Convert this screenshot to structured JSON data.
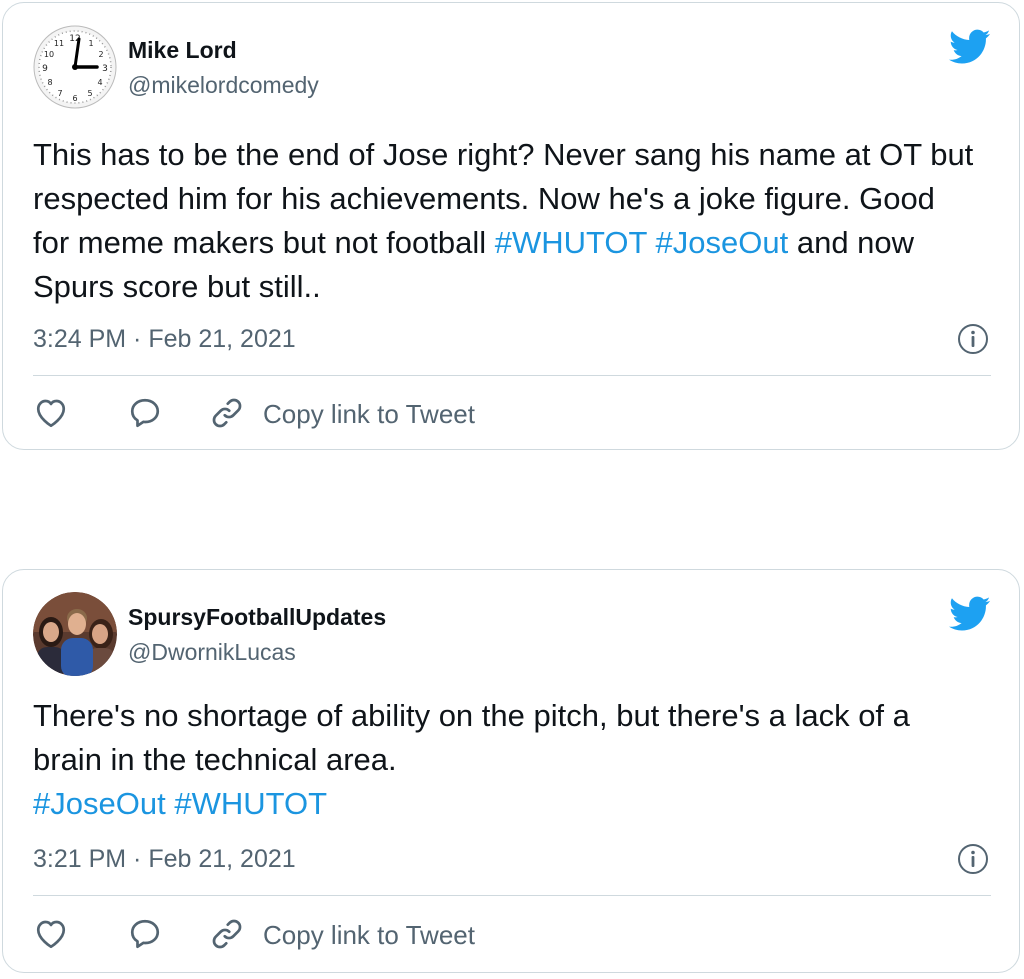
{
  "tweets": [
    {
      "author_name": "Mike Lord",
      "author_handle": "@mikelordcomedy",
      "avatar": "clock-avatar",
      "text_plain": "This has to be the end of Jose right? Never sang his name at OT but respected him for his achievements. Now he's a joke figure. Good for meme makers but not football ",
      "hashtag_1": "#WHUTOT",
      "hashtag_2": "#JoseOut",
      "text_after": " and now Spurs score but still..",
      "timestamp": "3:24 PM · Feb 21, 2021",
      "copy_link_label": "Copy link to Tweet"
    },
    {
      "author_name": "SpursyFootballUpdates",
      "author_handle": "@DwornikLucas",
      "avatar": "photo-avatar",
      "text_plain": "There's no shortage of ability on the pitch, but there's a lack of a brain in the technical area.",
      "hashtag_1": "#JoseOut",
      "hashtag_2": "#WHUTOT",
      "timestamp": "3:21 PM · Feb 21, 2021",
      "copy_link_label": "Copy link to Tweet"
    }
  ],
  "colors": {
    "accent": "#1b95e0",
    "twitter_blue": "#1da1f2",
    "secondary_text": "#536471",
    "border": "#cfd9de"
  },
  "icons": [
    "twitter-bird-icon",
    "info-icon",
    "heart-icon",
    "reply-icon",
    "link-icon"
  ]
}
